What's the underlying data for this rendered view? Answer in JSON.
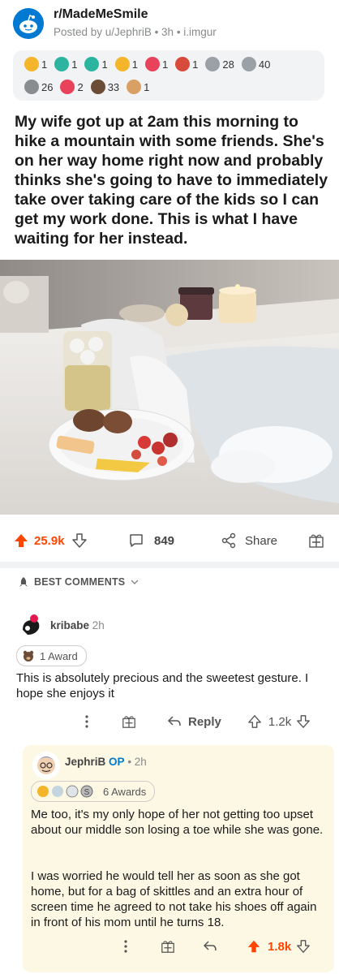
{
  "post": {
    "subreddit": "r/MadeMeSmile",
    "meta": "Posted by u/JephriB • 3h • i.imgur",
    "awards_row1": [
      {
        "icon": "arrow-up-award-icon",
        "count": "1",
        "color": "#f5b52b"
      },
      {
        "icon": "helpful-award-icon",
        "count": "1",
        "color": "#2bb5a0"
      },
      {
        "icon": "wholesome-award-icon",
        "count": "1",
        "color": "#2bb5a0"
      },
      {
        "icon": "gold-award-icon",
        "count": "1",
        "color": "#f5b52b"
      },
      {
        "icon": "heart-award-icon",
        "count": "1",
        "color": "#e8435a"
      },
      {
        "icon": "hug-award-icon",
        "count": "1",
        "color": "#d84a3c"
      },
      {
        "icon": "bravo-award-icon",
        "count": "28",
        "color": "#9aa0a6"
      },
      {
        "icon": "chat-award-icon",
        "count": "40",
        "color": "#9aa0a6"
      }
    ],
    "awards_row2": [
      {
        "icon": "silver-coin-award-icon",
        "count": "26",
        "color": "#8a8d90"
      },
      {
        "icon": "heart-eyes-award-icon",
        "count": "2",
        "color": "#e8435a"
      },
      {
        "icon": "bear-award-icon",
        "count": "33",
        "color": "#6b4c36"
      },
      {
        "icon": "wholesome-seal-award-icon",
        "count": "1",
        "color": "#d8a063"
      }
    ],
    "title": "My wife got up at 2am this morning to hike a mountain with some friends. She's on her way home right now and probably thinks she's going to have to immediately take over taking care of the kids so I can get my work done. This is what I have waiting for her instead.",
    "score": "25.9k",
    "comments_count": "849",
    "share_label": "Share"
  },
  "comments_header": "BEST COMMENTS",
  "comments": [
    {
      "user": "kribabe",
      "time": "2h",
      "award_label": "1 Award",
      "text": "This is absolutely precious and the sweetest gesture. I hope she enjoys it",
      "reply_label": "Reply",
      "score": "1.2k"
    },
    {
      "user": "JephriB",
      "op_label": "OP",
      "time": "• 2h",
      "award_label": "6 Awards",
      "text1": "Me too, it's my only hope of her not getting too upset about our middle son losing a toe while she was gone.",
      "text2": "I was worried he would tell her as soon as she got home, but for a bag of skittles and an extra hour of screen time he agreed to not take his shoes off again in front of his mom until he turns 18.",
      "score": "1.8k"
    }
  ],
  "colors": {
    "upvote": "#ff4500",
    "op": "#0079d3",
    "reply_bg": "#fcf8e3"
  }
}
